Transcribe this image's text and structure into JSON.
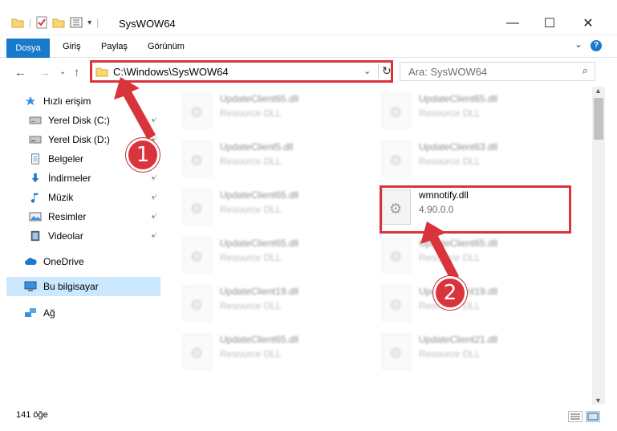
{
  "window": {
    "title": "SysWOW64",
    "minimize_icon": "—",
    "maximize_icon": "☐",
    "close_icon": "✕"
  },
  "ribbon": {
    "tabs": [
      "Dosya",
      "Giriş",
      "Paylaş",
      "Görünüm"
    ],
    "help_icon": "?",
    "expand_icon": "⌄"
  },
  "address": {
    "back": "←",
    "forward": "→",
    "recent": "⌄",
    "up": "↑",
    "path": "C:\\Windows\\SysWOW64",
    "dropdown": "⌄",
    "refresh": "↻"
  },
  "search": {
    "placeholder": "Ara: SysWOW64",
    "icon": "⌕"
  },
  "sidebar": {
    "items": [
      {
        "label": "Hızlı erişim",
        "icon": "star-icon"
      },
      {
        "label": "Yerel Disk (C:)",
        "icon": "drive-icon",
        "pinned": true
      },
      {
        "label": "Yerel Disk (D:)",
        "icon": "drive-icon",
        "pinned": true
      },
      {
        "label": "Belgeler",
        "icon": "documents-icon",
        "pinned": true
      },
      {
        "label": "İndirmeler",
        "icon": "download-icon",
        "pinned": true
      },
      {
        "label": "Müzik",
        "icon": "music-icon",
        "pinned": true
      },
      {
        "label": "Resimler",
        "icon": "pictures-icon",
        "pinned": true
      },
      {
        "label": "Videolar",
        "icon": "videos-icon",
        "pinned": true
      },
      {
        "label": "OneDrive",
        "icon": "cloud-icon"
      },
      {
        "label": "Bu bilgisayar",
        "icon": "computer-icon",
        "selected": true
      },
      {
        "label": "Ağ",
        "icon": "network-icon"
      }
    ],
    "pin_glyph": "📌"
  },
  "files": [
    {
      "name": "UpdateClient65.dll",
      "type": "Resource DLL"
    },
    {
      "name": "UpdateClient65.dll",
      "type": "Resource DLL"
    },
    {
      "name": "UpdateClient5.dll",
      "type": "Resource DLL"
    },
    {
      "name": "UpdateClient63.dll",
      "type": "Resource DLL"
    },
    {
      "name": "UpdateClient65.dll",
      "type": "Resource DLL"
    },
    {
      "name": "wmnotify.dll",
      "type": "4.90.0.0"
    },
    {
      "name": "UpdateClient65.dll",
      "type": "Resource DLL"
    },
    {
      "name": "UpdateClient65.dll",
      "type": "Resource DLL"
    },
    {
      "name": "UpdateClient19.dll",
      "type": "Resource DLL"
    },
    {
      "name": "UpdateClient19.dll",
      "type": "Resource DLL"
    },
    {
      "name": "UpdateClient65.dll",
      "type": "Resource DLL"
    },
    {
      "name": "UpdateClient21.dll",
      "type": "Resource DLL"
    }
  ],
  "annotations": {
    "step1": "1",
    "step2": "2",
    "color": "#d9343c"
  },
  "status": {
    "count": "141 öğe"
  }
}
